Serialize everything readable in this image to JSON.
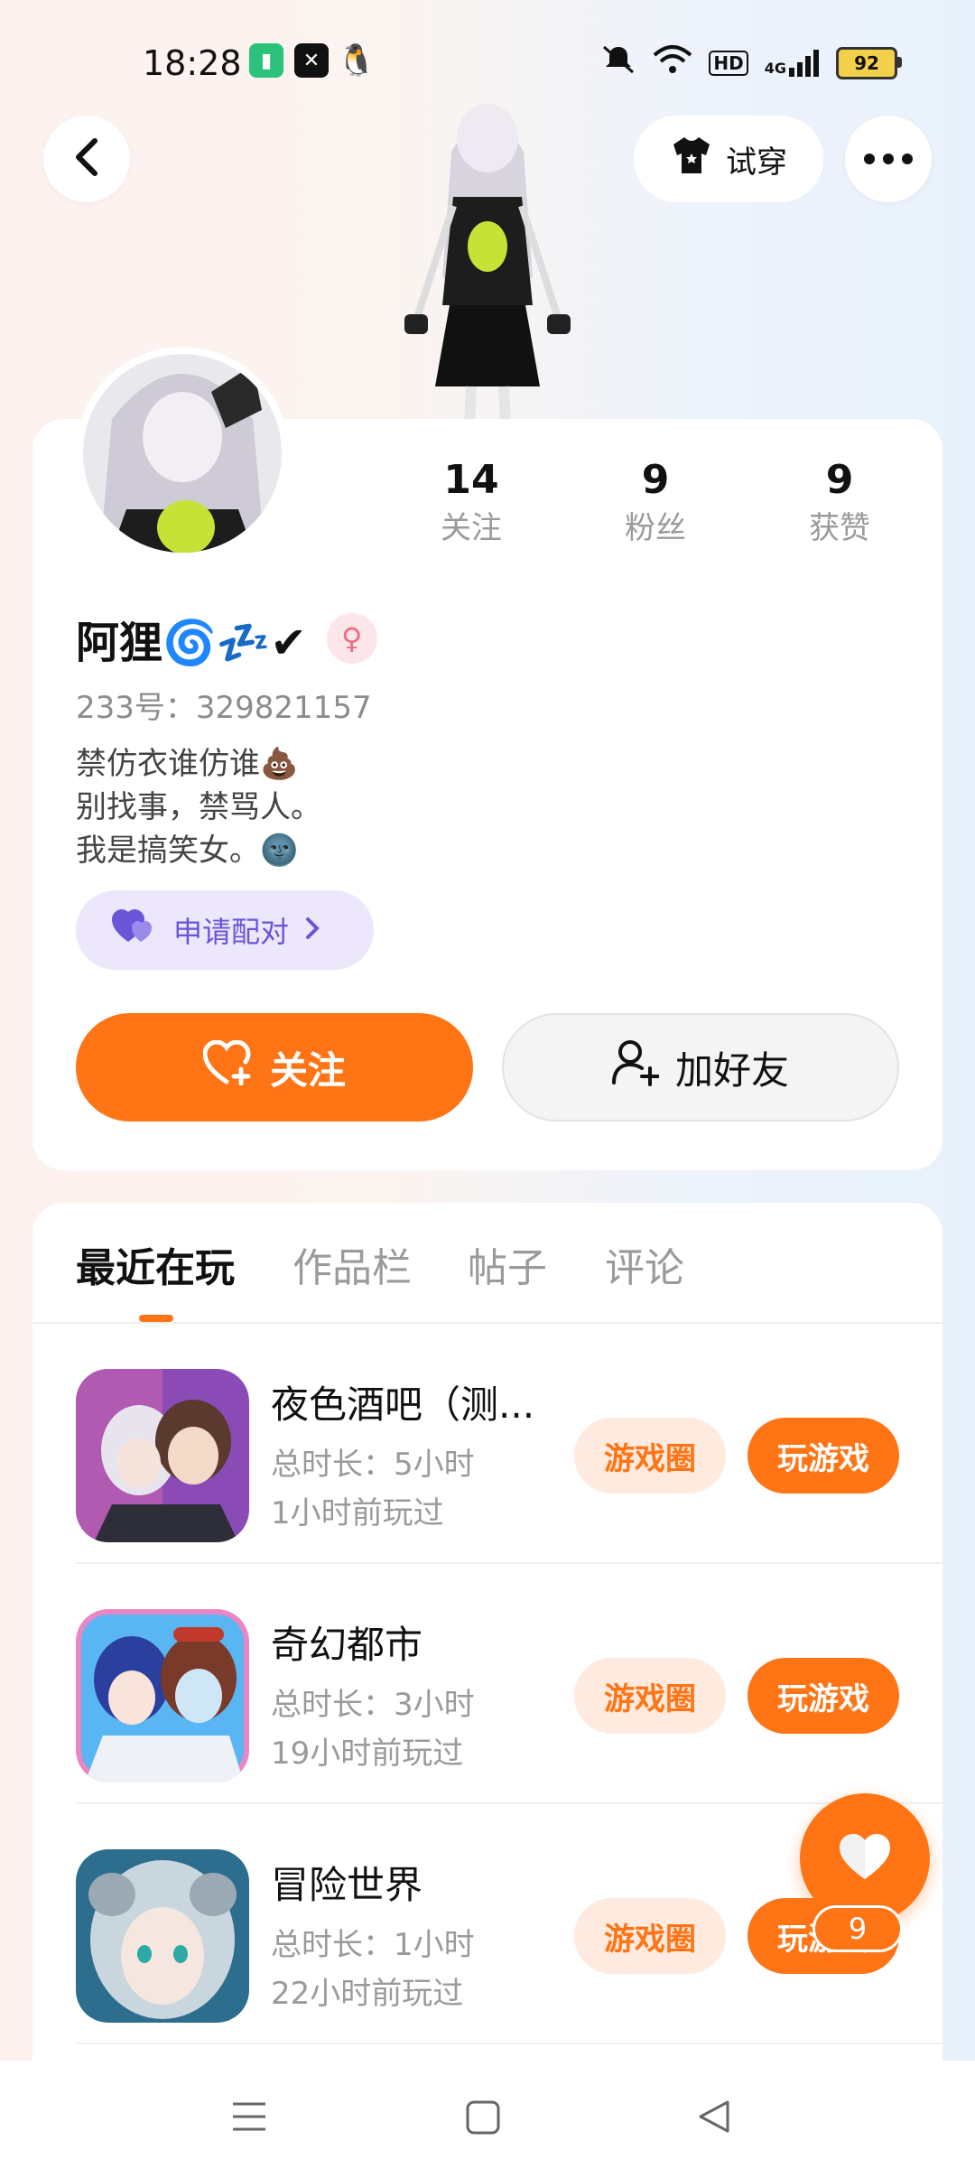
{
  "status_bar": {
    "time": "18:28",
    "battery": "92",
    "network_label": "HD",
    "signal_label": "4G"
  },
  "header": {
    "tryon_label": "试穿"
  },
  "profile": {
    "stats": [
      {
        "value": "14",
        "label": "关注"
      },
      {
        "value": "9",
        "label": "粉丝"
      },
      {
        "value": "9",
        "label": "获赞"
      }
    ],
    "name": "阿狸🌀💤✔",
    "gender_symbol": "♀",
    "id_text": "233号：329821157",
    "bio": [
      "禁仿衣谁仿谁💩",
      "别找事，禁骂人。",
      "我是搞笑女。🌚"
    ],
    "pair_label": "申请配对",
    "follow_label": "关注",
    "add_friend_label": "加好友"
  },
  "tabs": [
    {
      "label": "最近在玩",
      "active": true
    },
    {
      "label": "作品栏",
      "active": false
    },
    {
      "label": "帖子",
      "active": false
    },
    {
      "label": "评论",
      "active": false
    }
  ],
  "games": [
    {
      "title": "夜色酒吧（测...",
      "duration": "总时长：5小时",
      "last_played": "1小时前玩过",
      "circle_label": "游戏圈",
      "play_label": "玩游戏"
    },
    {
      "title": "奇幻都市",
      "duration": "总时长：3小时",
      "last_played": "19小时前玩过",
      "circle_label": "游戏圈",
      "play_label": "玩游戏"
    },
    {
      "title": "冒险世界",
      "duration": "总时长：1小时",
      "last_played": "22小时前玩过",
      "circle_label": "游戏圈",
      "play_label": "玩游戏"
    }
  ],
  "floating_like": {
    "count": "9"
  },
  "colors": {
    "accent": "#ff7415",
    "accent_light": "#feeade",
    "pair_bg": "#ece7fb",
    "pair_text": "#6a55d8"
  },
  "icons": {
    "back": "chevron-left-icon",
    "tryon": "tshirt-icon",
    "more": "more-dots-icon",
    "follow": "heart-plus-icon",
    "add_friend": "user-plus-icon",
    "pair": "hearts-icon",
    "like": "heart-icon"
  }
}
